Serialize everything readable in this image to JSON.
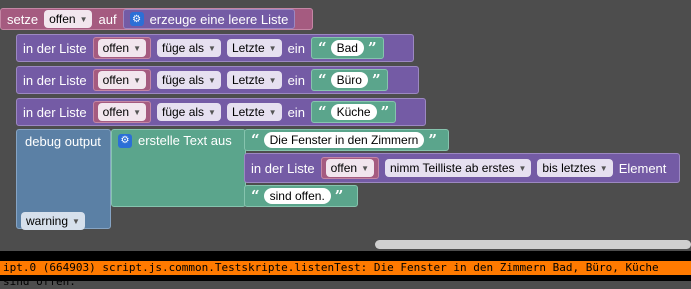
{
  "blocks": {
    "set": {
      "label": "setze",
      "var": "offen",
      "to": "auf",
      "create": "erzeuge eine leere Liste"
    },
    "adds": [
      {
        "in_list": "in der Liste",
        "var": "offen",
        "op": "füge als",
        "pos": "Letzte",
        "in": "ein",
        "value": "Bad"
      },
      {
        "in_list": "in der Liste",
        "var": "offen",
        "op": "füge als",
        "pos": "Letzte",
        "in": "ein",
        "value": "Büro"
      },
      {
        "in_list": "in der Liste",
        "var": "offen",
        "op": "füge als",
        "pos": "Letzte",
        "in": "ein",
        "value": "Küche"
      }
    ],
    "debug": {
      "label": "debug output",
      "create_text": "erstelle Text aus",
      "text1": "Die Fenster in den Zimmern",
      "in_list": "in der Liste",
      "var": "offen",
      "sublist_mode": "nimm Teilliste ab erstes",
      "until": "bis letztes",
      "element": "Element",
      "text3": "sind offen.",
      "level": "warning"
    }
  },
  "console": {
    "log": "ipt.0 (664903) script.js.common.Testskripte.listenTest: Die Fenster in den Zimmern Bad, Büro, Küche sind offen."
  },
  "colors": {
    "variable": "#a55b80",
    "list": "#745ba5",
    "text": "#5ba58c",
    "debug": "#5b80a5",
    "console_highlight": "#ff7a00",
    "workspace": "#4d4d4d"
  }
}
